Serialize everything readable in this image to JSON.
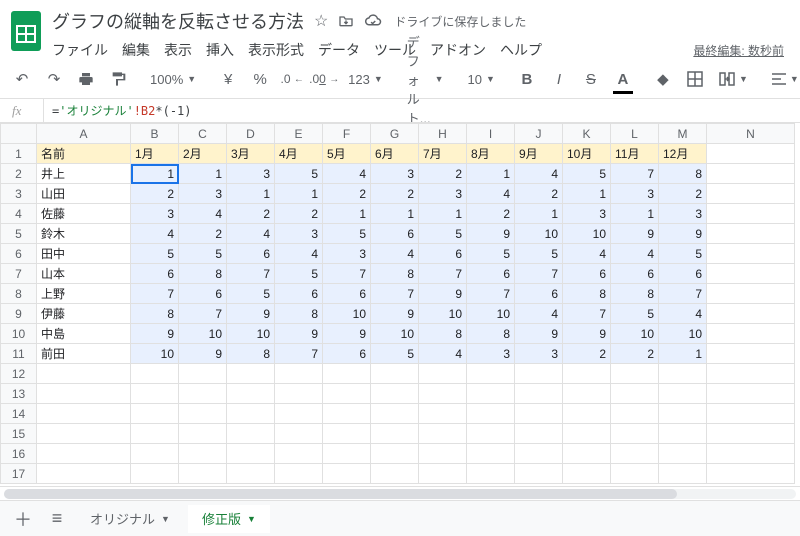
{
  "header": {
    "title": "グラフの縦軸を反転させる方法",
    "drive_status": "ドライブに保存しました",
    "last_edit": "最終編集: 数秒前"
  },
  "menus": [
    "ファイル",
    "編集",
    "表示",
    "挿入",
    "表示形式",
    "データ",
    "ツール",
    "アドオン",
    "ヘルプ"
  ],
  "toolbar": {
    "zoom": "100%",
    "currency": "¥",
    "percent": "%",
    "dec_dec": ".0",
    "inc_dec": ".00",
    "format": "123",
    "font": "デフォルト...",
    "font_size": "10"
  },
  "formula": {
    "prefix": "=",
    "string": "'オリジナル'",
    "ref": "!B2",
    "tail": "*(-1)"
  },
  "columns": [
    "A",
    "B",
    "C",
    "D",
    "E",
    "F",
    "G",
    "H",
    "I",
    "J",
    "K",
    "L",
    "M",
    "N"
  ],
  "row_count_total": 17,
  "chart_data": {
    "type": "table",
    "header_name": "名前",
    "months": [
      "1月",
      "2月",
      "3月",
      "4月",
      "5月",
      "6月",
      "7月",
      "8月",
      "9月",
      "10月",
      "11月",
      "12月"
    ],
    "rows": [
      {
        "name": "井上",
        "values": [
          1,
          1,
          3,
          5,
          4,
          3,
          2,
          1,
          4,
          5,
          7,
          8
        ]
      },
      {
        "name": "山田",
        "values": [
          2,
          3,
          1,
          1,
          2,
          2,
          3,
          4,
          2,
          1,
          3,
          2
        ]
      },
      {
        "name": "佐藤",
        "values": [
          3,
          4,
          2,
          2,
          1,
          1,
          1,
          2,
          1,
          3,
          1,
          3
        ]
      },
      {
        "name": "鈴木",
        "values": [
          4,
          2,
          4,
          3,
          5,
          6,
          5,
          9,
          10,
          10,
          9,
          9
        ]
      },
      {
        "name": "田中",
        "values": [
          5,
          5,
          6,
          4,
          3,
          4,
          6,
          5,
          5,
          4,
          4,
          5
        ]
      },
      {
        "name": "山本",
        "values": [
          6,
          8,
          7,
          5,
          7,
          8,
          7,
          6,
          7,
          6,
          6,
          6
        ]
      },
      {
        "name": "上野",
        "values": [
          7,
          6,
          5,
          6,
          6,
          7,
          9,
          7,
          6,
          8,
          8,
          7
        ]
      },
      {
        "name": "伊藤",
        "values": [
          8,
          7,
          9,
          8,
          10,
          9,
          10,
          10,
          4,
          7,
          5,
          4
        ]
      },
      {
        "name": "中島",
        "values": [
          9,
          10,
          10,
          9,
          9,
          10,
          8,
          8,
          9,
          9,
          10,
          10
        ]
      },
      {
        "name": "前田",
        "values": [
          10,
          9,
          8,
          7,
          6,
          5,
          4,
          3,
          3,
          2,
          2,
          1
        ]
      }
    ]
  },
  "active_cell": "B2",
  "sheets": {
    "add_tooltip": "+",
    "all_tooltip": "≡",
    "tabs": [
      {
        "label": "オリジナル",
        "active": false
      },
      {
        "label": "修正版",
        "active": true
      }
    ]
  }
}
